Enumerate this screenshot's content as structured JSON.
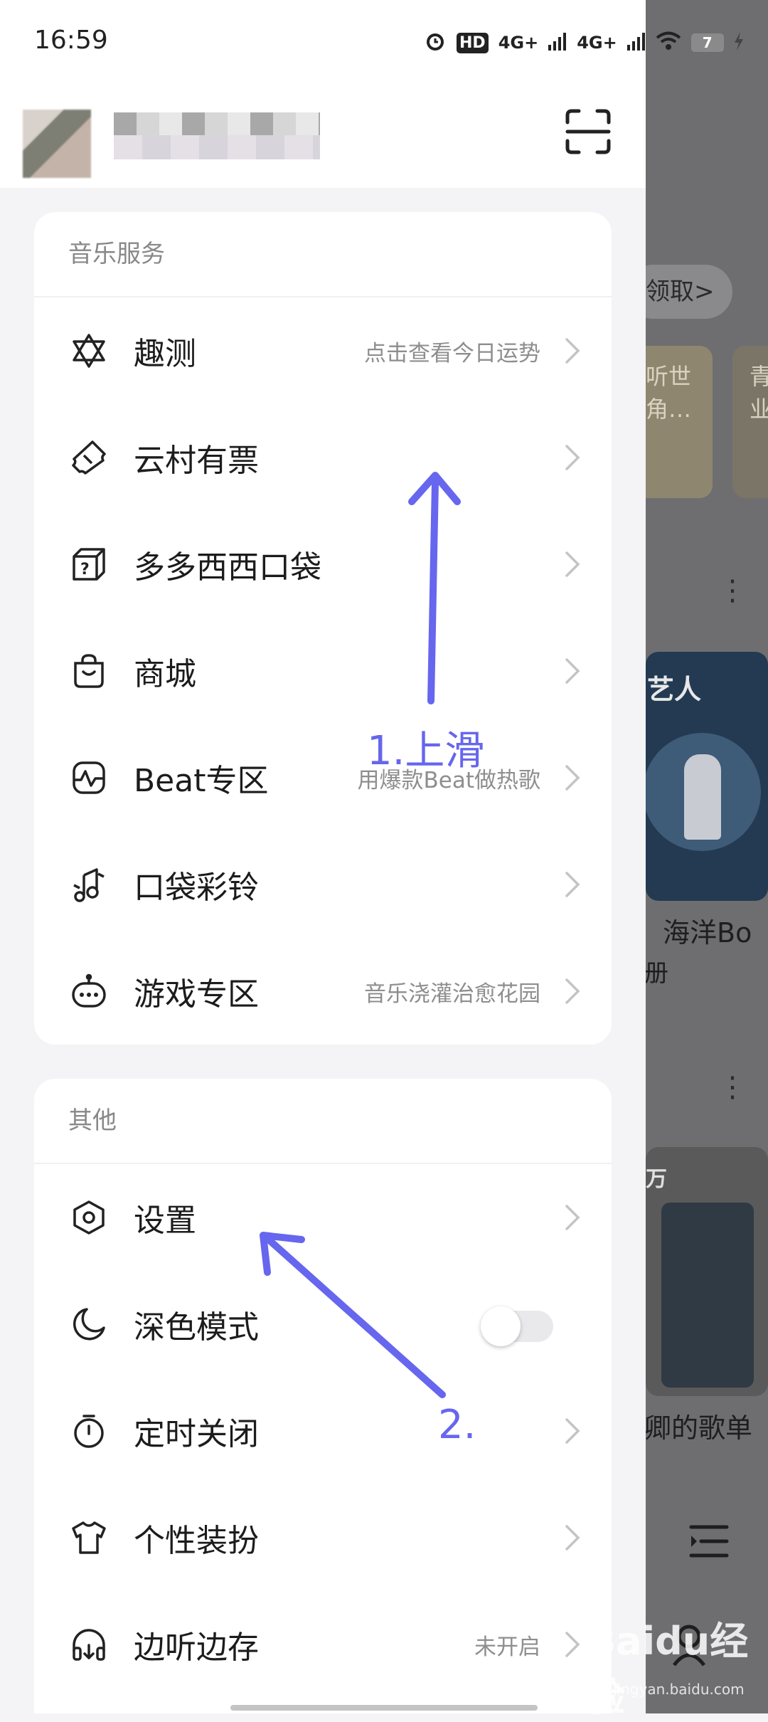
{
  "status_bar": {
    "time": "16:59",
    "battery": "7",
    "network1": "4G+",
    "network2": "4G+",
    "hd": "HD"
  },
  "sections": [
    {
      "title": "音乐服务",
      "items": [
        {
          "label": "趣测",
          "sub": "点击查看今日运势",
          "icon": "star-of-david-icon"
        },
        {
          "label": "云村有票",
          "sub": "",
          "icon": "ticket-icon"
        },
        {
          "label": "多多西西口袋",
          "sub": "",
          "icon": "mystery-box-icon"
        },
        {
          "label": "商城",
          "sub": "",
          "icon": "shopping-bag-icon"
        },
        {
          "label": "Beat专区",
          "sub": "用爆款Beat做热歌",
          "icon": "beat-wave-icon"
        },
        {
          "label": "口袋彩铃",
          "sub": "",
          "icon": "music-note-icon"
        },
        {
          "label": "游戏专区",
          "sub": "音乐浇灌治愈花园",
          "icon": "gamepad-icon"
        }
      ]
    },
    {
      "title": "其他",
      "items": [
        {
          "label": "设置",
          "sub": "",
          "icon": "settings-hexagon-icon"
        },
        {
          "label": "深色模式",
          "sub": "",
          "icon": "moon-icon",
          "toggle": false
        },
        {
          "label": "定时关闭",
          "sub": "",
          "icon": "timer-icon"
        },
        {
          "label": "个性装扮",
          "sub": "",
          "icon": "tshirt-icon"
        },
        {
          "label": "边听边存",
          "sub": "未开启",
          "icon": "headphones-icon"
        }
      ]
    }
  ],
  "annotations": {
    "step1": "1.上滑",
    "step2": "2."
  },
  "background": {
    "pill": "领取>",
    "card1_text": "听世\n角…",
    "card2_text": "青\n业",
    "artist_tag": "艺人",
    "artist_name": "海洋Bo",
    "artist_sub": "册",
    "tag2": "万",
    "playlist": "卿的歌单"
  },
  "watermark": {
    "text": "Baidu经验",
    "sub": "jingyan.baidu.com"
  },
  "colors": {
    "accent_annotation": "#6666ee",
    "scrim": "#6e6e70",
    "card_bg": "#ffffff",
    "page_bg": "#f4f4f6"
  }
}
